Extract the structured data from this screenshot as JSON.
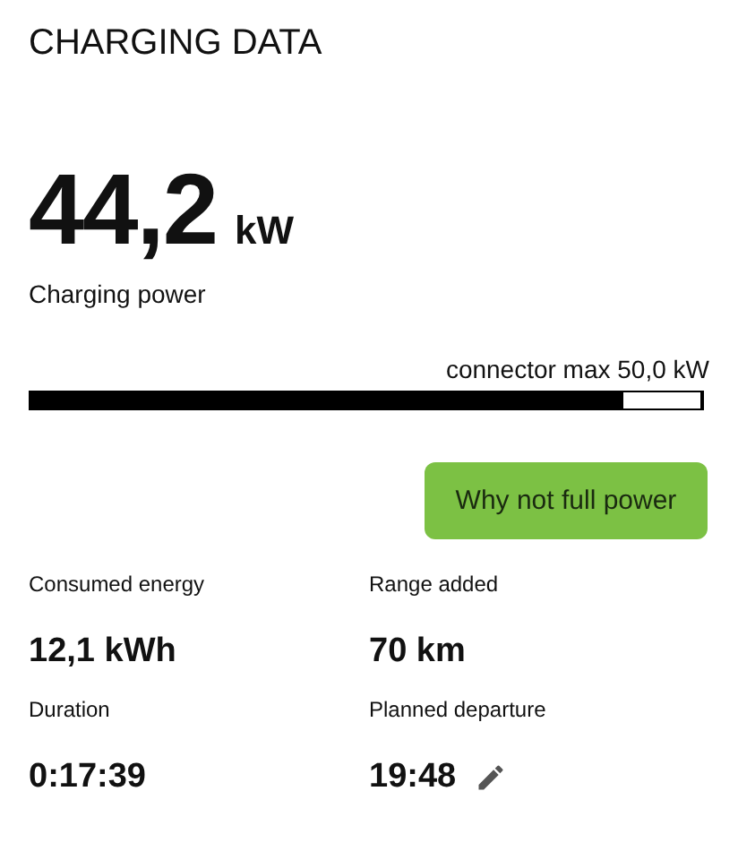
{
  "title": "CHARGING DATA",
  "power": {
    "value": "44,2",
    "unit": "kW",
    "label": "Charging power"
  },
  "meter": {
    "caption": "connector max 50,0 kW",
    "level": 0.884
  },
  "button": {
    "label": "Why not full power"
  },
  "stats": [
    {
      "label": "Consumed energy",
      "value": "12,1 kWh",
      "editable": false
    },
    {
      "label": "Range added",
      "value": "70 km",
      "editable": false
    },
    {
      "label": "Duration",
      "value": "0:17:39",
      "editable": false
    },
    {
      "label": "Planned departure",
      "value": "19:48",
      "editable": true
    }
  ]
}
